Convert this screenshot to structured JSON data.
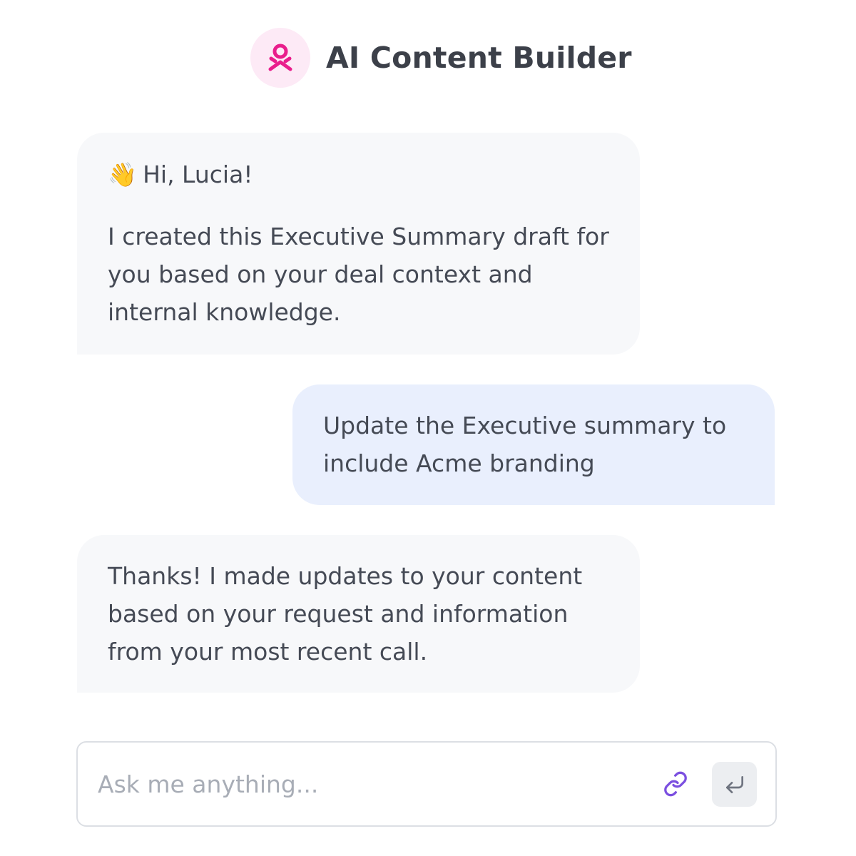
{
  "header": {
    "logo_icon": "person-logo-icon",
    "title": "AI Content Builder",
    "accent_color": "#e91e8c"
  },
  "messages": [
    {
      "role": "assistant",
      "greeting_emoji": "👋",
      "greeting": "Hi, Lucia!",
      "text": "I created this Executive Summary draft for you based on your deal context and internal knowledge."
    },
    {
      "role": "user",
      "text": "Update the Executive summary to include Acme branding"
    },
    {
      "role": "assistant",
      "text": "Thanks! I made updates to your content based on your request and information from your most recent call."
    }
  ],
  "composer": {
    "placeholder": "Ask me anything...",
    "value": "",
    "attach_icon": "link-icon",
    "send_icon": "enter-icon",
    "attach_color": "#7b4fe0"
  }
}
